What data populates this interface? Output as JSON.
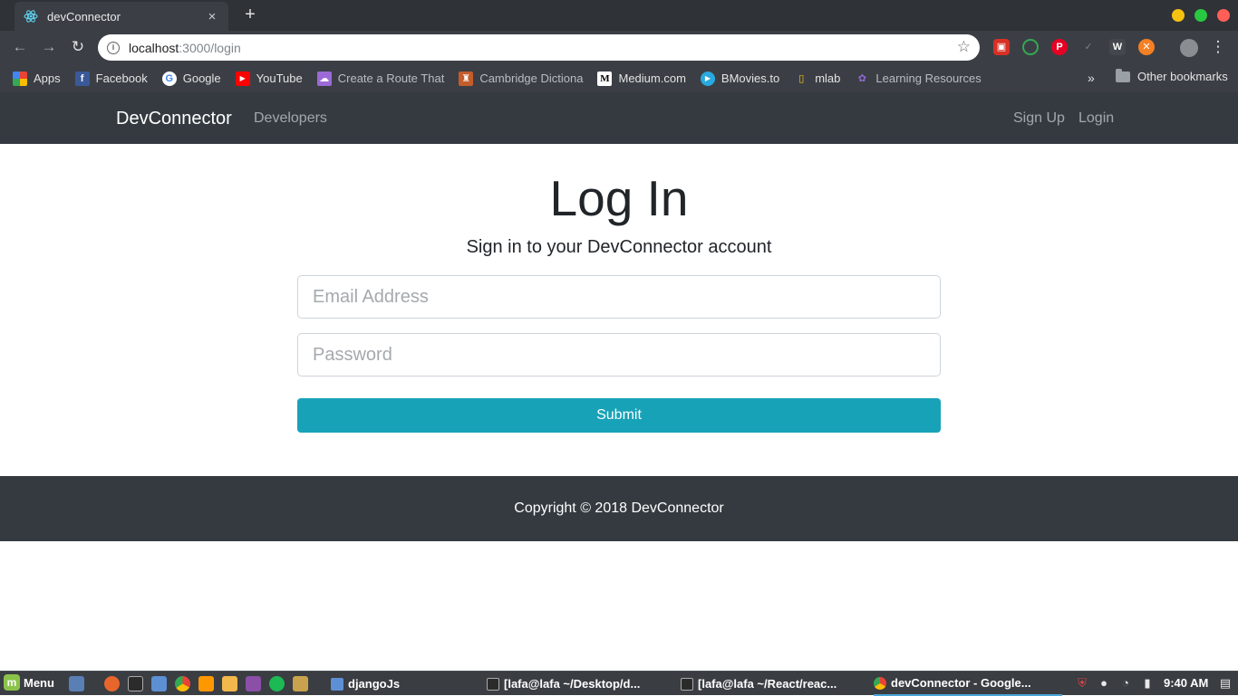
{
  "browser": {
    "tab": {
      "title": "devConnector",
      "close": "×"
    },
    "new_tab": "+",
    "url_host": "localhost",
    "url_path": ":3000/login",
    "bookmarks": [
      {
        "label": "Apps",
        "icon": "apps-grid-icon",
        "color": "#e94235"
      },
      {
        "label": "Facebook",
        "icon": "facebook-icon",
        "color": "#3b5998"
      },
      {
        "label": "Google",
        "icon": "google-icon",
        "color": "#ffffff"
      },
      {
        "label": "YouTube",
        "icon": "youtube-icon",
        "color": "#ff0000"
      },
      {
        "label": "Create a Route That",
        "icon": "cloud-icon",
        "color": "#9c6ad6"
      },
      {
        "label": "Cambridge Dictiona",
        "icon": "cambridge-icon",
        "color": "#c45c2b"
      },
      {
        "label": "Medium.com",
        "icon": "medium-icon",
        "color": "#000000"
      },
      {
        "label": "BMovies.to",
        "icon": "play-icon",
        "color": "#29a9df"
      },
      {
        "label": "mlab",
        "icon": "mlab-icon",
        "color": "#f5c518"
      },
      {
        "label": "Learning Resources",
        "icon": "learning-icon",
        "color": "#6c4ad6"
      }
    ],
    "more": "»",
    "other_bookmarks": "Other bookmarks"
  },
  "app": {
    "brand": "DevConnector",
    "nav": {
      "developers": "Developers",
      "signup": "Sign Up",
      "login": "Login"
    }
  },
  "page": {
    "title": "Log In",
    "lead": "Sign in to your DevConnector account",
    "email_placeholder": "Email Address",
    "password_placeholder": "Password",
    "submit": "Submit"
  },
  "footer": {
    "copyright": "Copyright © 2018 DevConnector"
  },
  "taskbar": {
    "menu": "Menu",
    "tasks": [
      {
        "label": "djangoJs"
      },
      {
        "label": "[lafa@lafa ~/Desktop/d..."
      },
      {
        "label": "[lafa@lafa ~/React/reac..."
      },
      {
        "label": "devConnector - Google..."
      }
    ],
    "clock": "9:40 AM"
  },
  "colors": {
    "navbar": "#343a40",
    "submit": "#17a2b8",
    "chrome_dark": "#2f3237",
    "chrome_toolbar": "#3b3f45"
  }
}
